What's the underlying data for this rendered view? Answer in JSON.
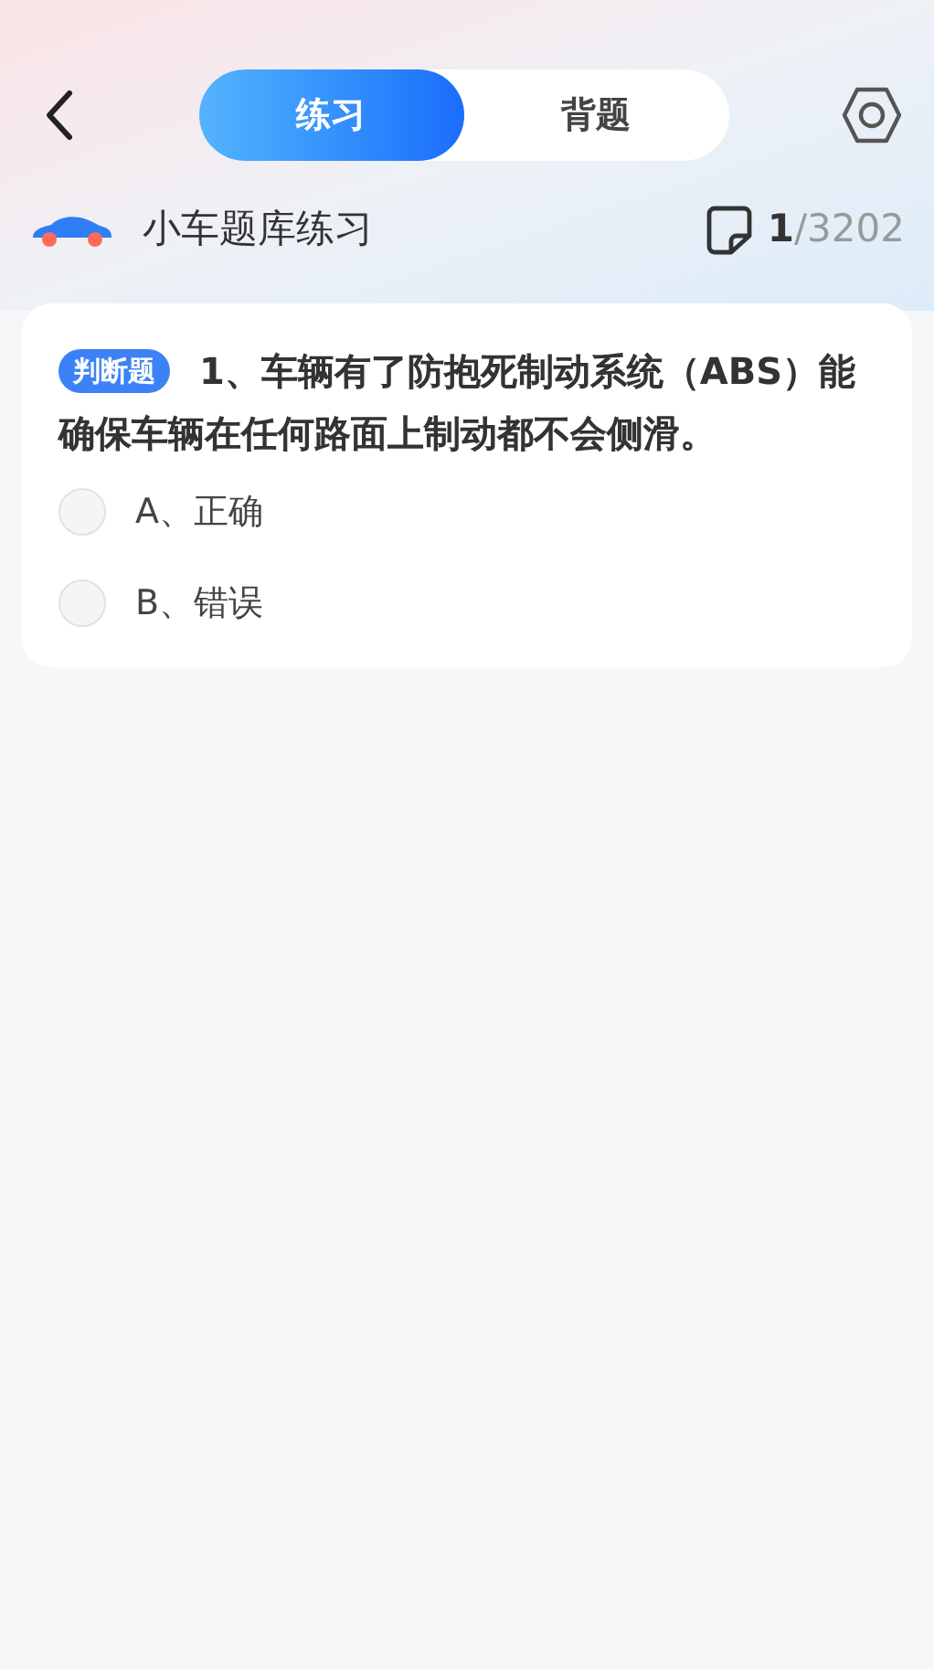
{
  "tabs": [
    {
      "label": "练习",
      "selected": true
    },
    {
      "label": "背题",
      "selected": false
    }
  ],
  "bank": {
    "title": "小车题库练习",
    "current": "1",
    "total": "/3202"
  },
  "question": {
    "tag": "判断题",
    "text": "1、车辆有了防抱死制动系统（ABS）能确保车辆在任何路面上制动都不会侧滑。",
    "options": [
      {
        "label": "A、正确",
        "selected": false
      },
      {
        "label": "B、错误",
        "selected": false
      }
    ]
  }
}
